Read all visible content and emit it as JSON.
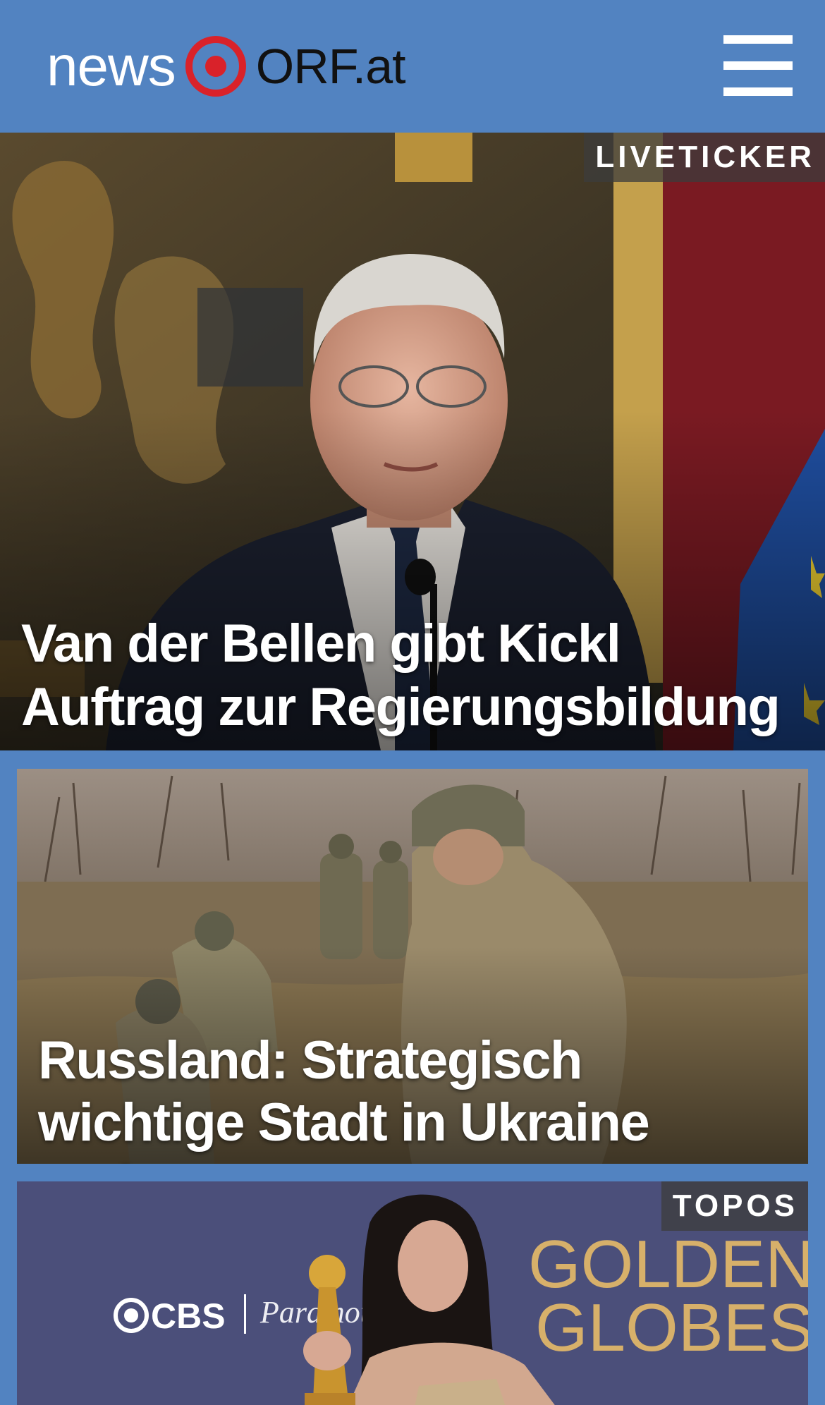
{
  "header": {
    "logo_news": "news",
    "logo_orf": "ORF.at",
    "menu_icon": "hamburger-menu-icon",
    "bg_color": "#5283c1",
    "logo_red": "#d9222a"
  },
  "articles": [
    {
      "badge": "LIVETICKER",
      "headline": "Van der Bellen gibt Kickl Auftrag zur Regierungsbildung",
      "image": "president-speaking-photo"
    },
    {
      "badge": "",
      "headline": "Russland: Strategisch wichtige Stadt in Ukraine erobert",
      "image": "soldiers-in-field-photo"
    },
    {
      "badge": "TOPOS",
      "headline": "",
      "image": "golden-globes-award-photo",
      "image_text": {
        "cbs": "CBS",
        "paramount": "Paramount",
        "golden": "GOLDEN",
        "globes": "GLOBES"
      }
    }
  ]
}
